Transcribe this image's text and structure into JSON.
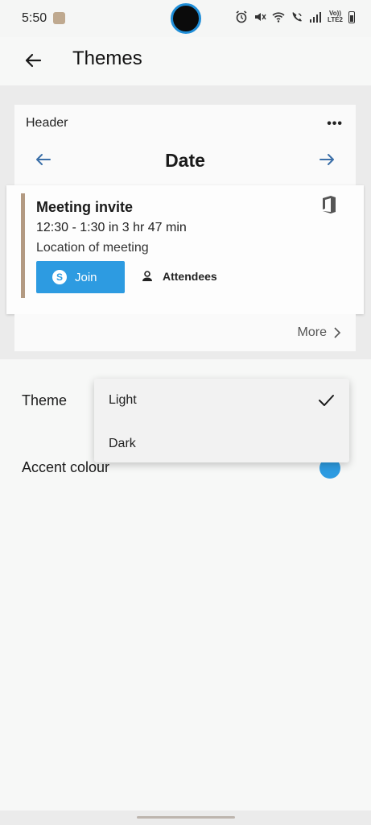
{
  "status_bar": {
    "time": "5:50",
    "icons": [
      "alarm-icon",
      "mute-icon",
      "wifi-icon",
      "wifi-call-icon",
      "signal-icon",
      "volte-icon",
      "battery-icon"
    ],
    "volte_label_top": "Vo))",
    "volte_label_bottom": "LTE2"
  },
  "app_bar": {
    "title": "Themes"
  },
  "preview": {
    "header_text": "Header",
    "more_dots": "•••",
    "date_title": "Date",
    "meeting": {
      "title": "Meeting invite",
      "time": "12:30 - 1:30 in 3 hr 47 min",
      "location": "Location of meeting",
      "join_label": "Join",
      "attendees_label": "Attendees"
    },
    "more_label": "More"
  },
  "settings": {
    "theme_label": "Theme",
    "accent_label": "Accent colour",
    "accent_color": "#2d9be1"
  },
  "theme_dropdown": {
    "options": [
      "Light",
      "Dark"
    ],
    "selected": "Light"
  }
}
